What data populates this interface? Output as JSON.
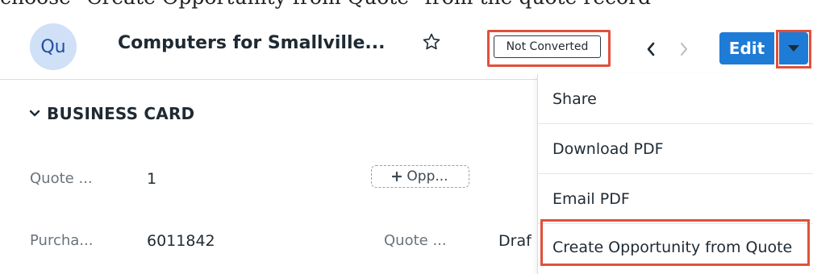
{
  "top_caption": "choose \"Create Opportunity from Quote\" from the quote record",
  "header": {
    "avatar": "Qu",
    "title": "Computers for Smallville...",
    "status_badge": "Not Converted",
    "edit_label": "Edit"
  },
  "section": {
    "title": "BUSINESS CARD"
  },
  "fields": [
    {
      "label": "Quote ...",
      "value": "1"
    },
    {
      "label": "Purcha...",
      "value": "6011842"
    }
  ],
  "opportunity_pill": {
    "label": "Opp..."
  },
  "field_right": {
    "label": "Quote ...",
    "value": "Draf"
  },
  "menu": {
    "items": [
      {
        "label": "Share"
      },
      {
        "label": "Download PDF"
      },
      {
        "label": "Email PDF"
      },
      {
        "label": "Create Opportunity from Quote"
      }
    ]
  },
  "colors": {
    "accent": "#1e7bd6",
    "highlight": "#e0503b",
    "avatar_bg": "#cfe0f7"
  }
}
